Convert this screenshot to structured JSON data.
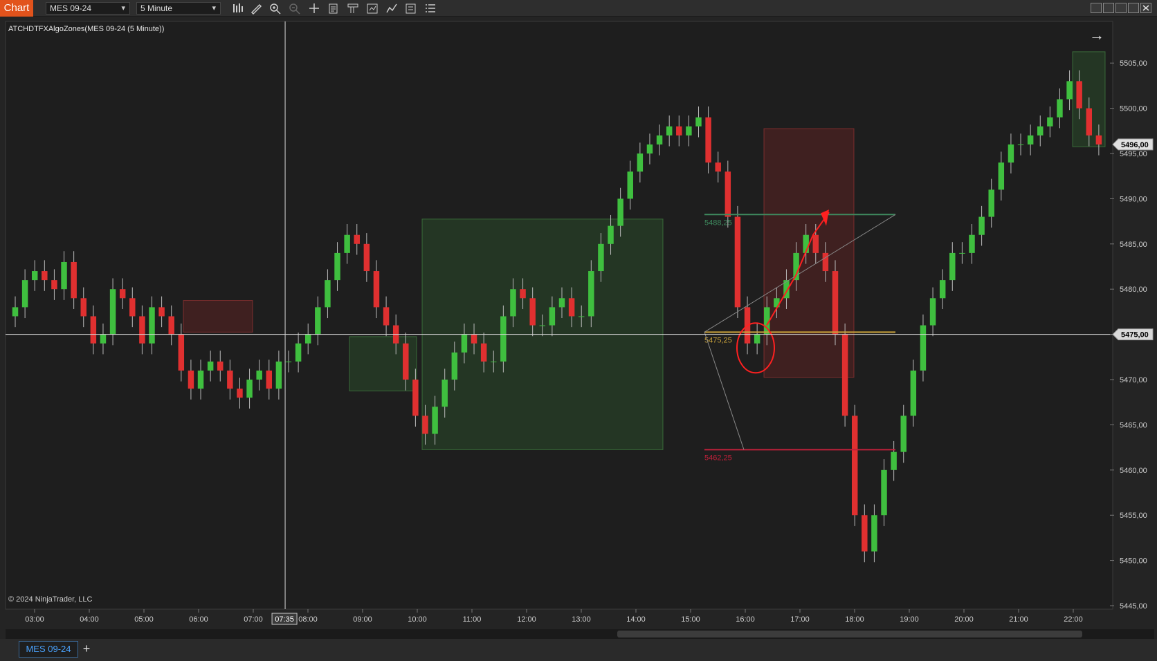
{
  "toolbar": {
    "chart_label": "Chart",
    "instrument": "MES 09-24",
    "interval": "5 Minute",
    "icons": [
      "bar-type-icon",
      "draw-tool-icon",
      "zoom-in-icon",
      "zoom-out-icon",
      "crosshair-icon",
      "data-box-icon",
      "templates-icon",
      "strategies-icon",
      "indicators-icon",
      "properties-icon",
      "list-icon"
    ]
  },
  "chart": {
    "indicator_title": "ATCHDTFXAlgoZones(MES 09-24 (5 Minute))",
    "copyright": "© 2024 NinjaTrader, LLC",
    "cursor_time_label": "07:35",
    "arrow_glyph": "→",
    "level_labels": {
      "upper": "5488,25",
      "middle": "5475,25",
      "lower": "5462,25"
    },
    "price_badges": {
      "last": "5496,00",
      "crosshair": "5475,00"
    },
    "colors": {
      "up": "#3fbf3f",
      "down": "#e03030",
      "background": "#1e1e1e",
      "accent": "#e2531c",
      "level_upper": "#3e8a5e",
      "level_middle": "#c9a23a",
      "level_lower": "#c0203a"
    }
  },
  "chart_data": {
    "type": "candlestick",
    "title": "ATCHDTFXAlgoZones(MES 09-24 (5 Minute))",
    "y_ticks": [
      "5505,00",
      "5500,00",
      "5495,00",
      "5490,00",
      "5485,00",
      "5480,00",
      "5475,00",
      "5470,00",
      "5465,00",
      "5460,00",
      "5455,00",
      "5450,00",
      "5445,00"
    ],
    "ylim": [
      5444.5,
      5508.5
    ],
    "x_ticks": [
      "03:00",
      "04:00",
      "05:00",
      "06:00",
      "07:00",
      "08:00",
      "09:00",
      "10:00",
      "11:00",
      "12:00",
      "13:00",
      "14:00",
      "15:00",
      "16:00",
      "17:00",
      "18:00",
      "19:00",
      "20:00",
      "21:00",
      "22:00"
    ],
    "closes": [
      5478,
      5481,
      5482,
      5481,
      5480,
      5483,
      5479,
      5477,
      5474,
      5475,
      5480,
      5479,
      5477,
      5474,
      5478,
      5477,
      5475,
      5471,
      5469,
      5471,
      5472,
      5471,
      5469,
      5468,
      5470,
      5471,
      5469,
      5472,
      5472,
      5474,
      5475,
      5478,
      5481,
      5484,
      5486,
      5485,
      5482,
      5478,
      5476,
      5474,
      5470,
      5466,
      5464,
      5467,
      5470,
      5473,
      5475,
      5474,
      5472,
      5472,
      5477,
      5480,
      5479,
      5476,
      5476,
      5478,
      5479,
      5477,
      5477,
      5482,
      5485,
      5487,
      5490,
      5493,
      5495,
      5496,
      5497,
      5498,
      5497,
      5498,
      5499,
      5494,
      5493,
      5488,
      5478,
      5474,
      5475,
      5478,
      5479,
      5481,
      5484,
      5486,
      5484,
      5482,
      5475,
      5466,
      5455,
      5451,
      5455,
      5460,
      5462,
      5466,
      5471,
      5476,
      5479,
      5481,
      5484,
      5484,
      5486,
      5488,
      5491,
      5494,
      5496,
      5496,
      5497,
      5498,
      5499,
      5501,
      5503,
      5500,
      5497,
      5496
    ],
    "zones": [
      {
        "type": "supply",
        "low": 5475.25,
        "high": 5478.75
      },
      {
        "type": "demand",
        "low": 5468.75,
        "high": 5474.75
      },
      {
        "type": "demand",
        "low": 5462.25,
        "high": 5487.75
      },
      {
        "type": "supply",
        "low": 5470.25,
        "high": 5497.75
      },
      {
        "type": "demand",
        "low": 5495.75,
        "high": 5506.25
      }
    ],
    "levels": [
      5488.25,
      5475.25,
      5462.25
    ],
    "last_price": 5496.0,
    "crosshair_price": 5475.0,
    "bar_interval": "5 Minute"
  },
  "tabs": {
    "active": "MES 09-24",
    "add": "+"
  }
}
